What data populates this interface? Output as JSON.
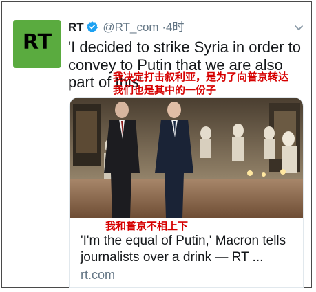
{
  "tweet": {
    "author_name": "RT",
    "handle": "@RT_com",
    "separator": "·",
    "time": "4时",
    "text": "'I decided to strike Syria in order to convey to Putin that we are also part of this'",
    "avatar_logo": "RT",
    "avatar_color": "#5aab3f"
  },
  "overlay": {
    "caption_top_line1": "我决定打击叙利亚，是为了向普京转达",
    "caption_top_line2": "我们也是其中的一份子",
    "caption_card": "我和普京不相上下",
    "color": "#d60000"
  },
  "card": {
    "title": "'I'm the equal of Putin,' Macron tells journalists over a drink — RT ...",
    "domain": "rt.com"
  },
  "icons": [
    "verified-icon",
    "chevron-down-icon"
  ]
}
